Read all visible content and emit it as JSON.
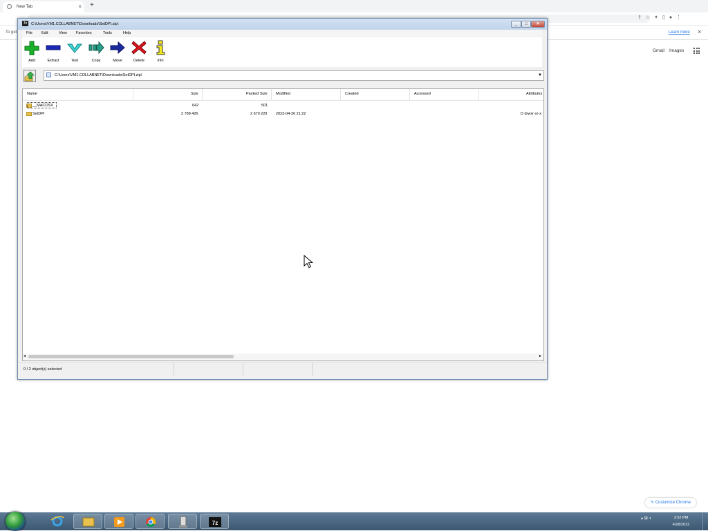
{
  "chrome": {
    "tab_title": "New Tab",
    "tab_close": "×",
    "new_tab": "+",
    "infobar_text": "To get",
    "learn_more": "Learn more",
    "infobar_close": "×",
    "gmail": "Gmail",
    "images": "Images",
    "customize": "Customize Chrome"
  },
  "zip": {
    "title": "C:\\Users\\VM1.COLLABNET\\Downloads\\SetDPI.zip\\",
    "menus": [
      "File",
      "Edit",
      "View",
      "Favorites",
      "Tools",
      "Help"
    ],
    "tools": [
      "Add",
      "Extract",
      "Test",
      "Copy",
      "Move",
      "Delete",
      "Info"
    ],
    "address": "C:\\Users\\VM1.COLLABNET\\Downloads\\SetDPI.zip\\",
    "columns": [
      "Name",
      "Size",
      "Packed Size",
      "Modified",
      "Created",
      "Accessed",
      "Attributes"
    ],
    "rows": [
      {
        "name": "__MACOSX",
        "size": "642",
        "packed": "501",
        "modified": "",
        "attributes": ""
      },
      {
        "name": "SetDPI",
        "size": "2 788 426",
        "packed": "2 670 229",
        "modified": "2023-04-26 21:22",
        "attributes": "D drwxr-xr-x"
      }
    ],
    "status": "0 / 2 object(s) selected"
  },
  "taskbar": {
    "time": "3:52 PM",
    "date": "4/28/2022",
    "apps": [
      "internet-explorer",
      "file-explorer",
      "media-player",
      "chrome",
      "usb-drive",
      "7zip"
    ]
  },
  "colors": {
    "titlebar": "#c8d8ec",
    "taskbar": "#4a6782",
    "link": "#1a73e8"
  }
}
